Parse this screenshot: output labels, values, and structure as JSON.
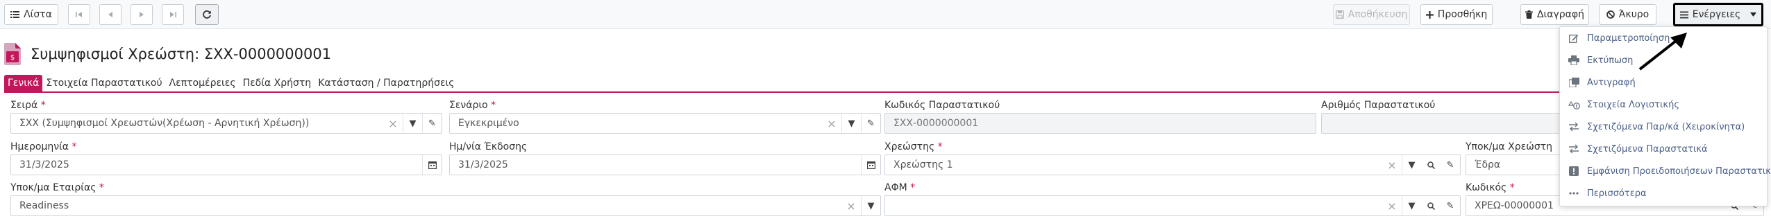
{
  "toolbar": {
    "list_label": "Λίστα",
    "save_label": "Αποθήκευση",
    "add_label": "Προσθήκη",
    "delete_label": "Διαγραφή",
    "cancel_label": "Άκυρο",
    "actions_label": "Ενέργειες"
  },
  "header": {
    "title": "Συμψηφισμοί Χρεώστη: ΣΧΧ-0000000001"
  },
  "tabs": [
    {
      "label": "Γενικά"
    },
    {
      "label": "Στοιχεία Παραστατικού"
    },
    {
      "label": "Λεπτομέρειες"
    },
    {
      "label": "Πεδία Χρήστη"
    },
    {
      "label": "Κατάσταση / Παρατηρήσεις"
    }
  ],
  "form": {
    "series": {
      "label": "Σειρά",
      "value": "ΣΧΧ (Συμψηφισμοί Χρεωστών(Χρέωση - Αρνητική Χρέωση))"
    },
    "scenario": {
      "label": "Σενάριο",
      "value": "Εγκεκριμένο"
    },
    "doc_code": {
      "label": "Κωδικός Παραστατικού",
      "value": "ΣΧΧ-0000000001"
    },
    "doc_number": {
      "label": "Αριθμός Παραστατικού",
      "value": ""
    },
    "date": {
      "label": "Ημερομηνία",
      "value": "31/3/2025"
    },
    "issue_date": {
      "label": "Ημ/νία Έκδοσης",
      "value": "31/3/2025"
    },
    "debtor": {
      "label": "Χρεώστης",
      "value": "Χρεώστης 1"
    },
    "debtor_branch": {
      "label": "Υποκ/μα Χρεώστη",
      "value": "Έδρα"
    },
    "company_branch": {
      "label": "Υποκ/μα Εταιρίας",
      "value": "Readiness"
    },
    "vat": {
      "label": "ΑΦΜ",
      "value": ""
    },
    "code": {
      "label": "Κωδικός",
      "value": "ΧΡΕΩ-00000001"
    }
  },
  "menu": {
    "items": [
      {
        "label": "Παραμετροποίηση",
        "icon": "edit-icon"
      },
      {
        "label": "Εκτύπωση",
        "icon": "printer-icon"
      },
      {
        "label": "Αντιγραφή",
        "icon": "copy-icon"
      },
      {
        "label": "Στοιχεία Λογιστικής",
        "icon": "accounting-icon"
      },
      {
        "label": "Σχετιζόμενα Παρ/κά (Χειροκίνητα)",
        "icon": "swap-icon"
      },
      {
        "label": "Σχετιζόμενα Παραστατικά",
        "icon": "swap-icon"
      },
      {
        "label": "Εμφάνιση Προειδοποιήσεων Παραστατικού",
        "icon": "warning-icon"
      },
      {
        "label": "Περισσότερα",
        "icon": "more-icon"
      }
    ]
  },
  "colors": {
    "accent": "#c2185b",
    "menu_text": "#4a5f86"
  }
}
